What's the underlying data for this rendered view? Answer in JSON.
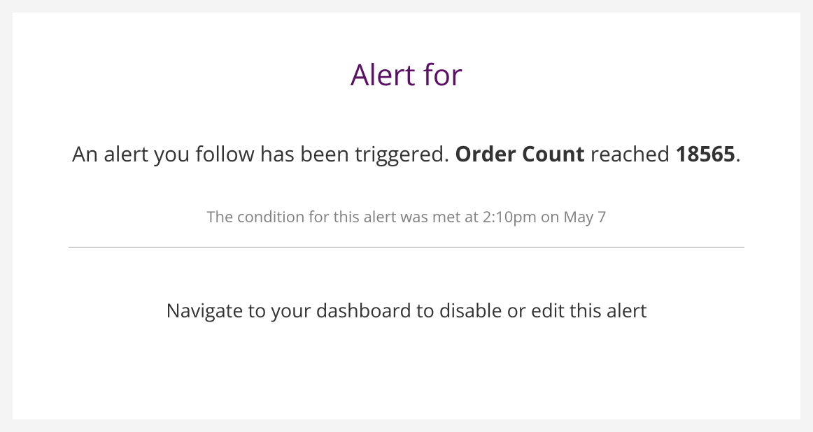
{
  "alert": {
    "title": "Alert for",
    "body_prefix": "An alert you follow has been triggered. ",
    "metric_name": "Order Count",
    "body_reached": " reached ",
    "metric_value": "18565",
    "body_period": ".",
    "condition_met_text": "The condition for this alert was met at 2:10pm on May 7",
    "footer_text": "Navigate to your dashboard to disable or edit this alert"
  }
}
